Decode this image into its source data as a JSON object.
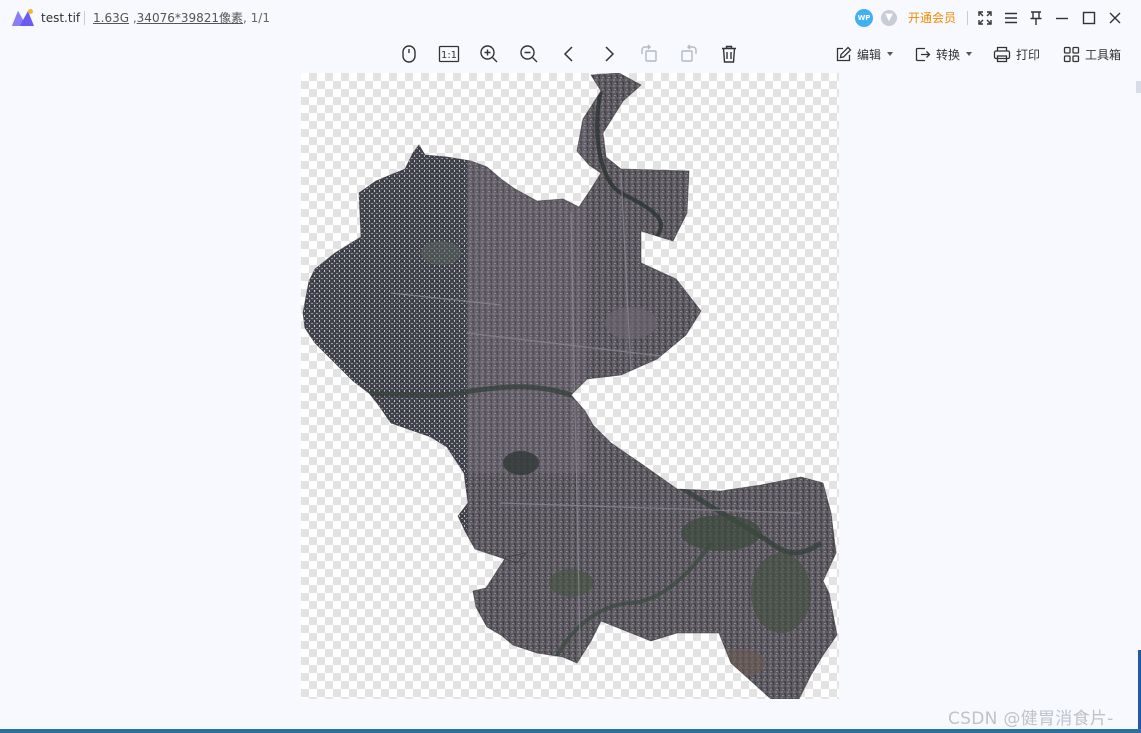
{
  "titlebar": {
    "file_name": "test.tif",
    "file_size": "1.63G",
    "dimensions": "34076*39821像素",
    "page_info": ", 1/1",
    "wp_badge": "WP",
    "vip_label": "开通会员"
  },
  "toolbar": {
    "fit_icon_name": "mouse-fit-icon",
    "actual_size_label": "1:1",
    "edit_label": "编辑",
    "convert_label": "转换",
    "print_label": "打印",
    "toolbox_label": "工具箱"
  },
  "colors": {
    "vip_orange": "#f08a00",
    "wp_blue": "#3fb0f3",
    "background": "#f7f9fe"
  },
  "watermark": "CSDN @健胃消食片-"
}
